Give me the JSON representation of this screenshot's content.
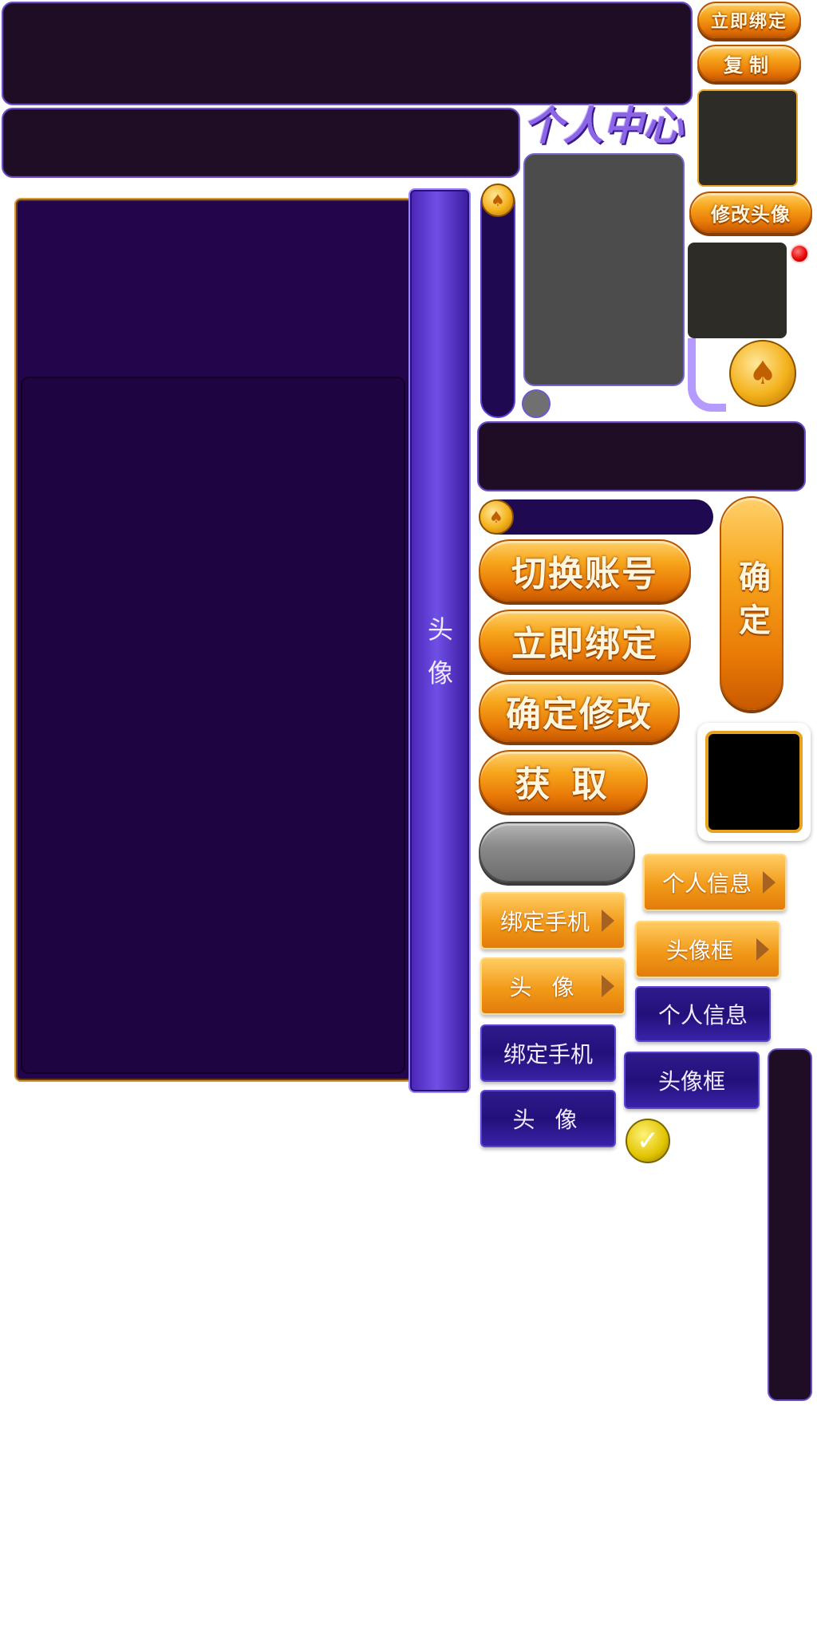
{
  "title": "个人中心",
  "buttons": {
    "bind_now_small": "立即绑定",
    "copy": "复制",
    "change_avatar": "修改头像",
    "switch_account": "切换账号",
    "bind_now": "立即绑定",
    "confirm_change": "确定修改",
    "fetch": "获 取",
    "confirm": "确定"
  },
  "side_tab_label": "头 像",
  "tabs_orange": {
    "personal_info": "个人信息",
    "bind_phone": "绑定手机",
    "avatar_frame": "头像框",
    "avatar": "头 像"
  },
  "tabs_purple": {
    "personal_info": "个人信息",
    "bind_phone": "绑定手机",
    "avatar_frame": "头像框",
    "avatar": "头 像"
  },
  "colors": {
    "orange": "#f29a18",
    "purple_panel": "#1e0440",
    "dark_bar": "#1f0d25",
    "title_purple": "#7b56d8"
  },
  "icons": {
    "coin": "spade-coin-icon",
    "check": "check-icon",
    "red_dot": "red-dot-icon"
  }
}
